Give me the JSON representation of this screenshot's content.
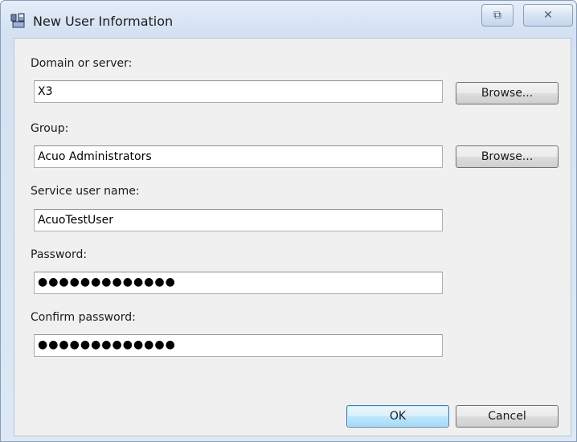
{
  "window": {
    "title": "New User Information"
  },
  "titlebar": {
    "restore_glyph": "⧉",
    "close_glyph": "✕"
  },
  "form": {
    "domain": {
      "label": "Domain or server:",
      "value": "X3",
      "browse_label": "Browse..."
    },
    "group": {
      "label": "Group:",
      "value": "Acuo Administrators",
      "browse_label": "Browse..."
    },
    "service_user": {
      "label": "Service user name:",
      "value": "AcuoTestUser"
    },
    "password": {
      "label": "Password:",
      "masked": "●●●●●●●●●●●●●"
    },
    "confirm_password": {
      "label": "Confirm password:",
      "masked": "●●●●●●●●●●●●●"
    }
  },
  "footer": {
    "ok_label": "OK",
    "cancel_label": "Cancel"
  },
  "colors": {
    "title_bar": "#d3e1f2",
    "client_bg": "#f0f0f0",
    "ok_accent": "#3c7fb1"
  },
  "icons": {
    "app": "disk-network-icon"
  }
}
